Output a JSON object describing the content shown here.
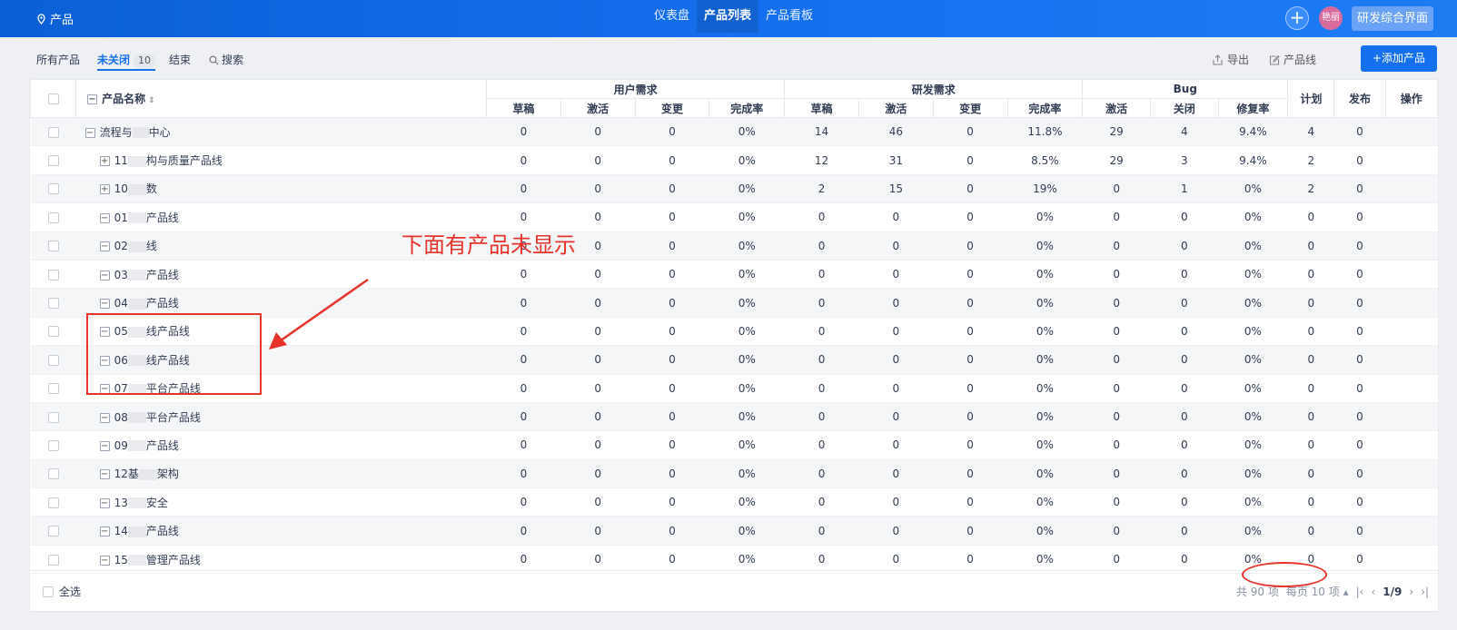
{
  "topbar": {
    "brand": "产品",
    "nav": [
      {
        "label": "仪表盘",
        "active": false
      },
      {
        "label": "产品列表",
        "active": true
      },
      {
        "label": "产品看板",
        "active": false
      }
    ],
    "plus": "+",
    "avatar": "艳丽",
    "workspace": "研发综合界面"
  },
  "subbar": {
    "tabs": [
      {
        "label": "所有产品"
      },
      {
        "label": "未关闭",
        "badge": "10"
      },
      {
        "label": "结束"
      },
      {
        "label": "搜索"
      }
    ],
    "export": "导出",
    "productline": "产品线",
    "add": "+添加产品"
  },
  "table": {
    "headers": {
      "name": "产品名称",
      "user_req": "用户需求",
      "dev_req": "研发需求",
      "bug": "Bug",
      "plan": "计划",
      "release": "发布",
      "action": "操作",
      "sub": [
        "草稿",
        "激活",
        "变更",
        "完成率",
        "草稿",
        "激活",
        "变更",
        "完成率",
        "激活",
        "关闭",
        "修复率"
      ]
    },
    "rows": [
      {
        "name": "流程与",
        "tail": "中心",
        "toggle": "−",
        "level": 0,
        "values": [
          "0",
          "0",
          "0",
          "0%",
          "14",
          "46",
          "0",
          "11.8%",
          "29",
          "4",
          "9.4%",
          "4",
          "0"
        ]
      },
      {
        "name": "11",
        "tail": "构与质量产品线",
        "toggle": "+",
        "level": 1,
        "values": [
          "0",
          "0",
          "0",
          "0%",
          "12",
          "31",
          "0",
          "8.5%",
          "29",
          "3",
          "9.4%",
          "2",
          "0"
        ]
      },
      {
        "name": "10",
        "tail": "数",
        "toggle": "+",
        "level": 1,
        "values": [
          "0",
          "0",
          "0",
          "0%",
          "2",
          "15",
          "0",
          "19%",
          "0",
          "1",
          "0%",
          "2",
          "0"
        ]
      },
      {
        "name": "01",
        "tail": "产品线",
        "toggle": "−",
        "level": 1,
        "values": [
          "0",
          "0",
          "0",
          "0%",
          "0",
          "0",
          "0",
          "0%",
          "0",
          "0",
          "0%",
          "0",
          "0"
        ]
      },
      {
        "name": "02",
        "tail": "线",
        "toggle": "−",
        "level": 1,
        "values": [
          "0",
          "0",
          "0",
          "0%",
          "0",
          "0",
          "0",
          "0%",
          "0",
          "0",
          "0%",
          "0",
          "0"
        ]
      },
      {
        "name": "03",
        "tail": "产品线",
        "toggle": "−",
        "level": 1,
        "values": [
          "0",
          "0",
          "0",
          "0%",
          "0",
          "0",
          "0",
          "0%",
          "0",
          "0",
          "0%",
          "0",
          "0"
        ]
      },
      {
        "name": "04",
        "tail": "产品线",
        "toggle": "−",
        "level": 1,
        "values": [
          "0",
          "0",
          "0",
          "0%",
          "0",
          "0",
          "0",
          "0%",
          "0",
          "0",
          "0%",
          "0",
          "0"
        ]
      },
      {
        "name": "05",
        "tail": "线产品线",
        "toggle": "−",
        "level": 1,
        "values": [
          "0",
          "0",
          "0",
          "0%",
          "0",
          "0",
          "0",
          "0%",
          "0",
          "0",
          "0%",
          "0",
          "0"
        ]
      },
      {
        "name": "06",
        "tail": "线产品线",
        "toggle": "−",
        "level": 1,
        "values": [
          "0",
          "0",
          "0",
          "0%",
          "0",
          "0",
          "0",
          "0%",
          "0",
          "0",
          "0%",
          "0",
          "0"
        ]
      },
      {
        "name": "07",
        "tail": "平台产品线",
        "toggle": "−",
        "level": 1,
        "values": [
          "0",
          "0",
          "0",
          "0%",
          "0",
          "0",
          "0",
          "0%",
          "0",
          "0",
          "0%",
          "0",
          "0"
        ]
      },
      {
        "name": "08",
        "tail": "平台产品线",
        "toggle": "−",
        "level": 1,
        "values": [
          "0",
          "0",
          "0",
          "0%",
          "0",
          "0",
          "0",
          "0%",
          "0",
          "0",
          "0%",
          "0",
          "0"
        ]
      },
      {
        "name": "09",
        "tail": "产品线",
        "toggle": "−",
        "level": 1,
        "values": [
          "0",
          "0",
          "0",
          "0%",
          "0",
          "0",
          "0",
          "0%",
          "0",
          "0",
          "0%",
          "0",
          "0"
        ]
      },
      {
        "name": "12基",
        "tail": "架构",
        "toggle": "−",
        "level": 1,
        "values": [
          "0",
          "0",
          "0",
          "0%",
          "0",
          "0",
          "0",
          "0%",
          "0",
          "0",
          "0%",
          "0",
          "0"
        ]
      },
      {
        "name": "13",
        "tail": "安全",
        "toggle": "−",
        "level": 1,
        "values": [
          "0",
          "0",
          "0",
          "0%",
          "0",
          "0",
          "0",
          "0%",
          "0",
          "0",
          "0%",
          "0",
          "0"
        ]
      },
      {
        "name": "14",
        "tail": "产品线",
        "toggle": "−",
        "level": 1,
        "values": [
          "0",
          "0",
          "0",
          "0%",
          "0",
          "0",
          "0",
          "0%",
          "0",
          "0",
          "0%",
          "0",
          "0"
        ]
      },
      {
        "name": "15",
        "tail": "管理产品线",
        "toggle": "−",
        "level": 1,
        "values": [
          "0",
          "0",
          "0",
          "0%",
          "0",
          "0",
          "0",
          "0%",
          "0",
          "0",
          "0%",
          "0",
          "0"
        ]
      }
    ]
  },
  "footer": {
    "select_all": "全选",
    "total": "共 90 项",
    "per_page": "每页 10 项",
    "page": "1/9"
  },
  "annotation": {
    "text": "下面有产品未显示"
  }
}
